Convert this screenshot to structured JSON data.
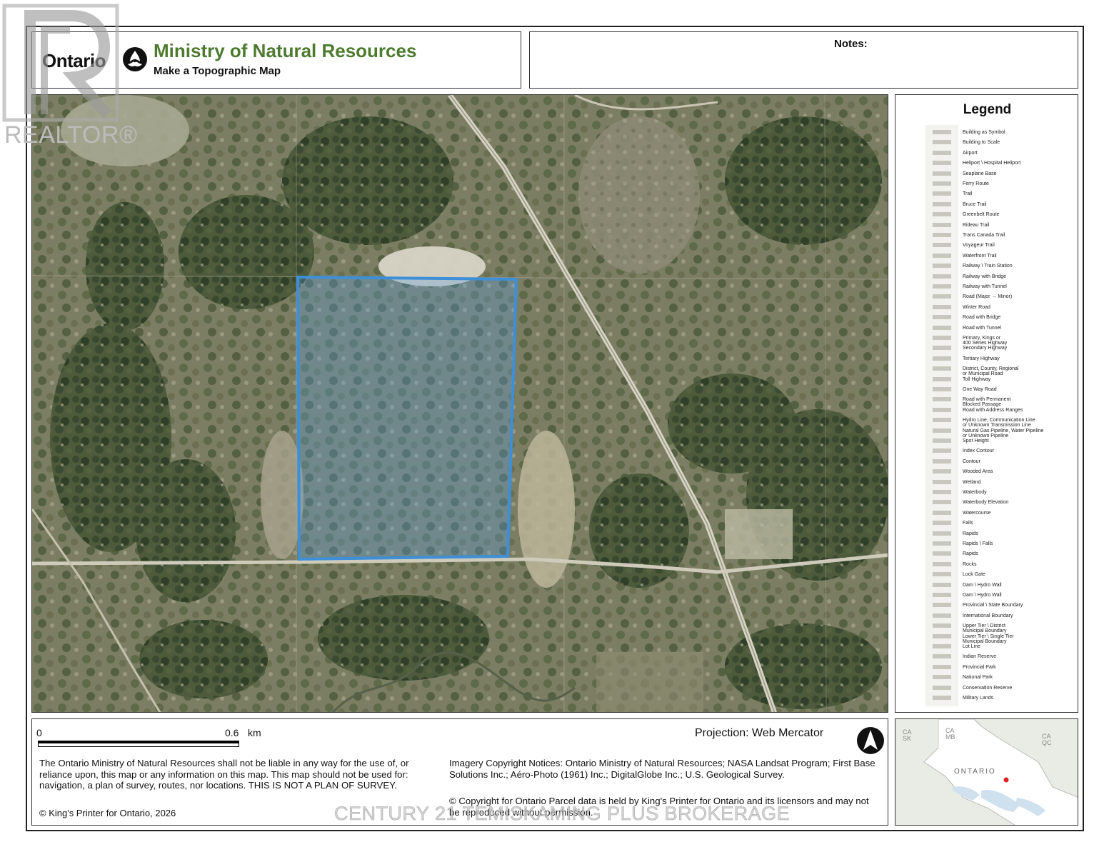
{
  "header": {
    "ontario_wordmark": "Ontario",
    "ministry_title": "Ministry of Natural Resources",
    "subtitle": "Make a Topographic Map",
    "title_color": "#4e7a2f"
  },
  "notes": {
    "label": "Notes:"
  },
  "map": {
    "type": "satellite-imagery",
    "parcel_outline_color": "#3d8fd8",
    "parcel_fill_color": "#5a9fe0",
    "features": [
      "highway",
      "township-roads",
      "lot-lines",
      "cleared-area",
      "creek"
    ]
  },
  "legend": {
    "title": "Legend",
    "items": [
      "Building as Symbol",
      "Building to Scale",
      "Airport",
      "Heliport \\ Hospital Heliport",
      "Seaplane Base",
      "Ferry Route",
      "Trail",
      "Bruce Trail",
      "Greenbelt Route",
      "Rideau Trail",
      "Trans Canada Trail",
      "Voyageur Trail",
      "Waterfront Trail",
      "Railway \\ Train Station",
      "Railway with Bridge",
      "Railway with Tunnel",
      "Road (Major → Minor)",
      "Winter Road",
      "Road with Bridge",
      "Road with Tunnel",
      "Primary, Kings or\n400 Series Highway",
      "Secondary Highway",
      "Tertiary Highway",
      "District, County, Regional\nor Municipal Road",
      "Toll Highway",
      "One Way Road",
      "Road with Permanent\nBlocked Passage",
      "Road with Address Ranges",
      "Hydro Line, Communication Line\nor Unknown Transmission Line",
      "Natural Gas Pipeline, Water Pipeline\nor Unknown Pipeline",
      "Spot Height",
      "Index Contour",
      "Contour",
      "Wooded Area",
      "Wetland",
      "Waterbody",
      "Waterbody Elevation",
      "Watercourse",
      "Falls",
      "Rapids",
      "Rapids \\ Falls",
      "Rapids",
      "Rocks",
      "Lock Gate",
      "Dam \\ Hydro Wall",
      "Dam \\ Hydro Wall",
      "Provincial \\ State Boundary",
      "International Boundary",
      "Upper Tier \\ District\nMunicipal Boundary",
      "Lower Tier \\ Single Tier\nMunicipal Boundary",
      "Lot Line",
      "Indian Reserve",
      "Provincial Park",
      "National Park",
      "Conservation Reserve",
      "Military Lands"
    ]
  },
  "scale": {
    "start": "0",
    "end": "0.6",
    "unit": "km"
  },
  "projection": "Projection: Web Mercator",
  "disclaimer": "The Ontario Ministry of Natural Resources shall not be liable in any way for the use of, or reliance upon, this map or any information on this map.  This map should not be used for: navigation, a plan of survey, routes, nor locations. THIS IS NOT A PLAN OF SURVEY.",
  "copyright_kp": "© King's Printer for Ontario,  2026",
  "imagery_notice": "Imagery Copyright Notices: Ontario Ministry of Natural Resources; NASA Landsat Program; First Base Solutions Inc.; Aéro-Photo (1961) Inc.; DigitalGlobe Inc.; U.S. Geological Survey.",
  "parcel_notice": "© Copyright for Ontario Parcel data is held by King's Printer for Ontario and its licensors and may not be reproduced without permission.",
  "inset": {
    "labels": [
      "CA\nSK",
      "CA\nMB",
      "CA\nQC"
    ],
    "province_label": "ONTARIO",
    "marker_color": "#e02020"
  },
  "watermarks": {
    "realtor": "REALTOR®",
    "brokerage": "CENTURY 21 TEMISKAMING PLUS BROKERAGE"
  }
}
